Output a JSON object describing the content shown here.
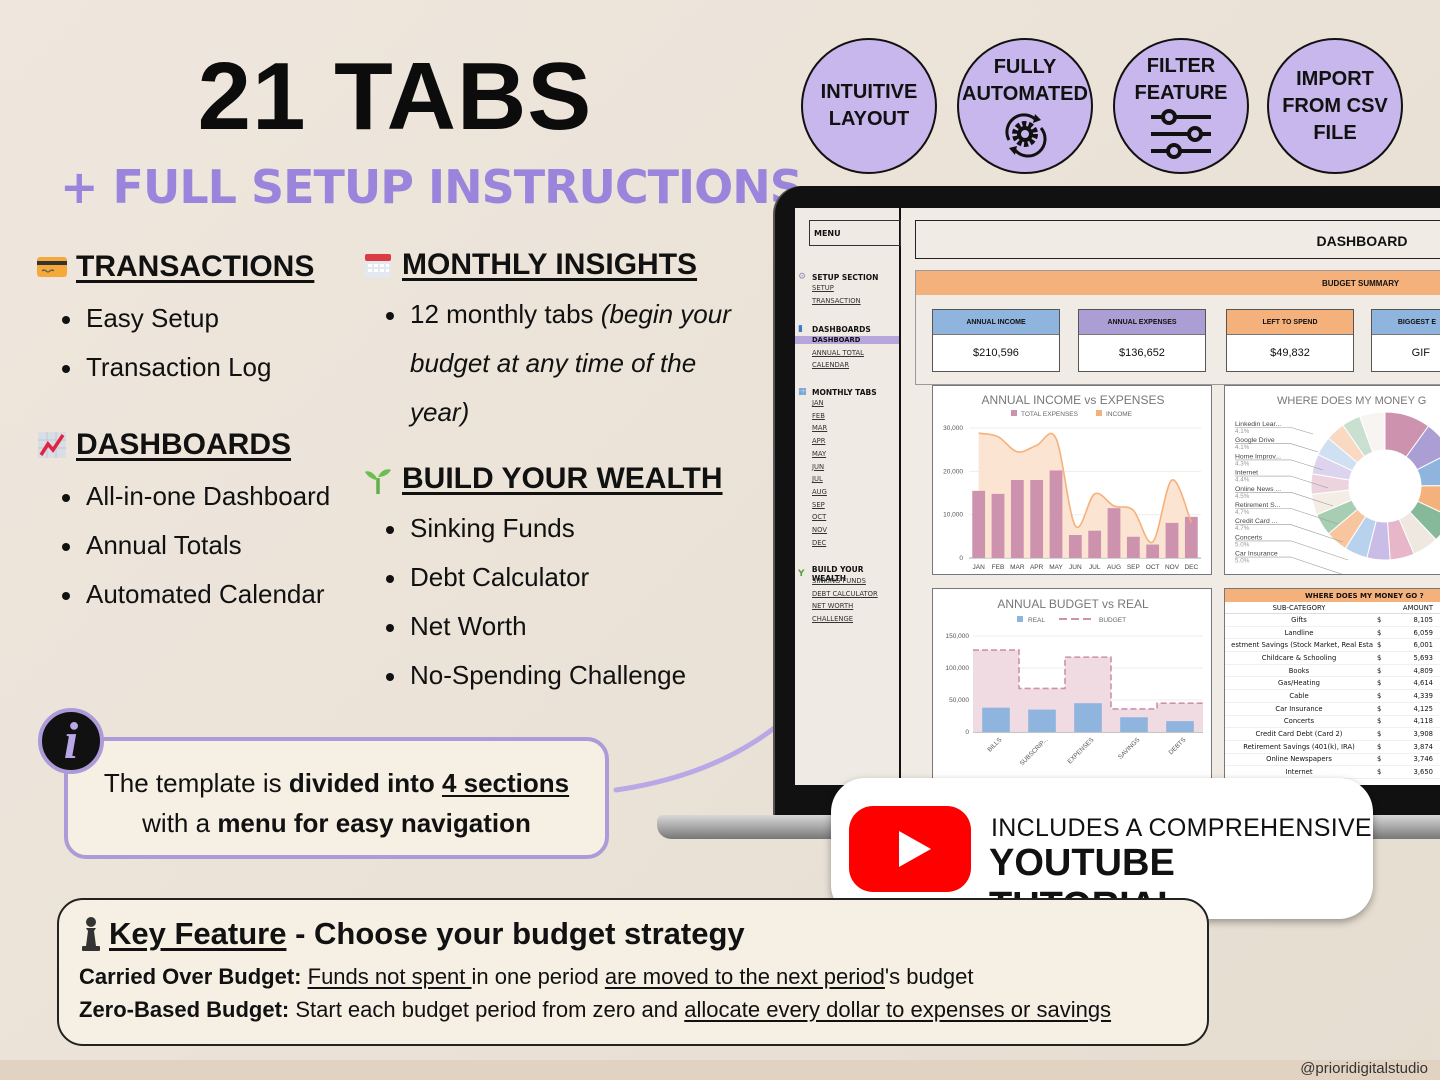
{
  "header": {
    "title": "21 TABS",
    "subtitle": "+ FULL SETUP INSTRUCTIONS"
  },
  "features": [
    {
      "label_lines": [
        "INTUITIVE",
        "LAYOUT"
      ],
      "icon": "none"
    },
    {
      "label_lines": [
        "FULLY",
        "AUTOMATED"
      ],
      "icon": "gear-cycle-icon"
    },
    {
      "label_lines": [
        "FILTER",
        "FEATURE"
      ],
      "icon": "sliders-icon"
    },
    {
      "label_lines": [
        "IMPORT",
        "FROM CSV",
        "FILE"
      ],
      "icon": "none"
    }
  ],
  "sections": {
    "transactions": {
      "heading": "TRANSACTIONS",
      "icon": "credit-card-icon",
      "items": [
        "Easy Setup",
        "Transaction Log"
      ]
    },
    "dashboards": {
      "heading": "DASHBOARDS",
      "icon": "chart-increasing-icon",
      "items": [
        "All-in-one Dashboard",
        "Annual Totals",
        "Automated Calendar"
      ]
    },
    "monthly": {
      "heading": "MONTHLY INSIGHTS",
      "icon": "calendar-icon",
      "item_plain": "12 monthly tabs ",
      "item_italic": "(begin your budget at any time of the year)"
    },
    "wealth": {
      "heading": "BUILD YOUR WEALTH",
      "icon": "seedling-icon",
      "items": [
        "Sinking Funds",
        "Debt Calculator",
        "Net Worth",
        "No-Spending Challenge"
      ]
    }
  },
  "info": {
    "p1": "The template is ",
    "b1": "divided into ",
    "u1": "4 sections",
    "p2": "with a ",
    "b2": "menu for easy navigation"
  },
  "key_feature": {
    "title_u": "Key Feature",
    "title_rest": " - Choose your budget strategy",
    "line1_label": "Carried Over Budget:",
    "line1_u1": "Funds not spent ",
    "line1_p1": "in one period ",
    "line1_u2": "are moved to the next period",
    "line1_p2": "'s budget",
    "line2_label": "Zero-Based Budget:",
    "line2_p1": " Start each budget period from zero and ",
    "line2_u1": "allocate every dollar to expenses or savings"
  },
  "youtube": {
    "line1": "INCLUDES A COMPREHENSIVE",
    "line2": "YOUTUBE TUTORIAL"
  },
  "handle": "@prioridigitalstudio",
  "spreadsheet": {
    "menu_title": "MENU",
    "groups": [
      {
        "label": "SETUP SECTION",
        "icon": "gear-icon",
        "links": [
          "SETUP",
          "TRANSACTION"
        ]
      },
      {
        "label": "DASHBOARDS",
        "icon": "bar-chart-icon",
        "links": [
          "DASHBOARD",
          "ANNUAL TOTAL",
          "CALENDAR"
        ]
      },
      {
        "label": "MONTHLY TABS",
        "icon": "calendar-icon",
        "links": [
          "JAN",
          "FEB",
          "MAR",
          "APR",
          "MAY",
          "JUN",
          "JUL",
          "AUG",
          "SEP",
          "OCT",
          "NOV",
          "DEC"
        ]
      },
      {
        "label": "BUILD YOUR WEALTH",
        "icon": "seedling-icon",
        "links": [
          "SINKING FUNDS",
          "DEBT CALCULATOR",
          "NET WORTH",
          "CHALLENGE"
        ]
      }
    ],
    "active_link": "DASHBOARD",
    "dashboard_title": "DASHBOARD",
    "budget_summary": "BUDGET SUMMARY",
    "kpis": [
      {
        "label": "ANNUAL INCOME",
        "value": "$210,596",
        "color": "#8fb4de"
      },
      {
        "label": "ANNUAL EXPENSES",
        "value": "$136,652",
        "color": "#ab9ed4"
      },
      {
        "label": "LEFT TO SPEND",
        "value": "$49,832",
        "color": "#f5b17c"
      },
      {
        "label": "BIGGEST E",
        "value": "GIF",
        "color": "#8fb4de"
      }
    ],
    "table": {
      "title": "WHERE DOES MY MONEY GO ?",
      "col_sub": "SUB-CATEGORY",
      "col_amt": "AMOUNT",
      "currency": "$",
      "rows": [
        {
          "sub": "Gifts",
          "amt": "8,105"
        },
        {
          "sub": "Landline",
          "amt": "6,059"
        },
        {
          "sub": "estment Savings (Stock Market, Real Esta",
          "amt": "6,001"
        },
        {
          "sub": "Childcare & Schooling",
          "amt": "5,693"
        },
        {
          "sub": "Books",
          "amt": "4,809"
        },
        {
          "sub": "Gas/Heating",
          "amt": "4,614"
        },
        {
          "sub": "Cable",
          "amt": "4,339"
        },
        {
          "sub": "Car Insurance",
          "amt": "4,125"
        },
        {
          "sub": "Concerts",
          "amt": "4,118"
        },
        {
          "sub": "Credit Card Debt (Card 2)",
          "amt": "3,908"
        },
        {
          "sub": "Retirement Savings (401(k), IRA)",
          "amt": "3,874"
        },
        {
          "sub": "Online Newspapers",
          "amt": "3,746"
        },
        {
          "sub": "Internet",
          "amt": "3,650"
        }
      ]
    }
  },
  "chart_data": [
    {
      "type": "bar",
      "title": "ANNUAL INCOME vs EXPENSES",
      "categories": [
        "JAN",
        "FEB",
        "MAR",
        "APR",
        "MAY",
        "JUN",
        "JUL",
        "AUG",
        "SEP",
        "OCT",
        "NOV",
        "DEC"
      ],
      "series": [
        {
          "name": "TOTAL EXPENSES",
          "kind": "bar",
          "color": "#cc92ae",
          "values": [
            15500,
            14800,
            18000,
            18000,
            20200,
            5300,
            6300,
            11500,
            4900,
            3100,
            8100,
            9500
          ]
        },
        {
          "name": "INCOME",
          "kind": "area-smooth",
          "color": "#f5b17c",
          "values": [
            28800,
            28000,
            24500,
            26000,
            27600,
            7400,
            14800,
            12000,
            11000,
            3700,
            18000,
            8200
          ]
        }
      ],
      "yticks": [
        "0",
        "10,000",
        "20,000",
        "30,000"
      ],
      "ylim": [
        0,
        30000
      ],
      "legend": "top",
      "grid": true
    },
    {
      "type": "pie",
      "title": "WHERE DOES MY MONEY G",
      "donut": true,
      "labels": [
        {
          "name": "Linkedin Lear...",
          "pct": "4.1%"
        },
        {
          "name": "Google Drive",
          "pct": "4.1%"
        },
        {
          "name": "Home Improv...",
          "pct": "4.3%"
        },
        {
          "name": "Internet",
          "pct": "4.4%"
        },
        {
          "name": "Online News ...",
          "pct": "4.5%"
        },
        {
          "name": "Retirement S...",
          "pct": "4.7%"
        },
        {
          "name": "Credit Card ...",
          "pct": "4.7%"
        },
        {
          "name": "Concerts",
          "pct": "5.0%"
        },
        {
          "name": "Car Insurance",
          "pct": "5.0%"
        }
      ],
      "slices": [
        {
          "value": 8.1,
          "color": "#cc92ae"
        },
        {
          "value": 6.1,
          "color": "#ab9ed4"
        },
        {
          "value": 6.0,
          "color": "#8fb4de"
        },
        {
          "value": 5.7,
          "color": "#f5b17c"
        },
        {
          "value": 4.8,
          "color": "#86b99a"
        },
        {
          "value": 4.6,
          "color": "#efe8e0"
        },
        {
          "value": 4.3,
          "color": "#e7b6c8"
        },
        {
          "value": 4.1,
          "color": "#c9bde7"
        },
        {
          "value": 4.1,
          "color": "#b8d2ee"
        },
        {
          "value": 3.9,
          "color": "#f7c69f"
        },
        {
          "value": 3.9,
          "color": "#a7cdb3"
        },
        {
          "value": 3.7,
          "color": "#f3ede6"
        },
        {
          "value": 3.6,
          "color": "#edd3de"
        },
        {
          "value": 3.5,
          "color": "#dcd4ef"
        },
        {
          "value": 3.4,
          "color": "#cfe0f2"
        },
        {
          "value": 3.4,
          "color": "#fad9c2"
        },
        {
          "value": 3.3,
          "color": "#c9e0d0"
        },
        {
          "value": 4.5,
          "color": "#f7f4f1"
        }
      ]
    },
    {
      "type": "bar",
      "title": "ANNUAL BUDGET vs REAL",
      "categories": [
        "BILLS",
        "SUBSCRIP...",
        "EXPENSES",
        "SAVINGS",
        "DEBTS"
      ],
      "series": [
        {
          "name": "REAL",
          "kind": "bar",
          "color": "#8fb4de",
          "values": [
            38000,
            35000,
            45000,
            23000,
            17000
          ]
        },
        {
          "name": "BUDGET",
          "kind": "stepped-area-dashed",
          "color": "#cc92ae",
          "values": [
            128000,
            68000,
            117000,
            36000,
            45000
          ]
        }
      ],
      "yticks": [
        "0",
        "50,000",
        "100,000",
        "150,000"
      ],
      "ylim": [
        0,
        150000
      ],
      "legend": "top",
      "grid": true
    }
  ]
}
